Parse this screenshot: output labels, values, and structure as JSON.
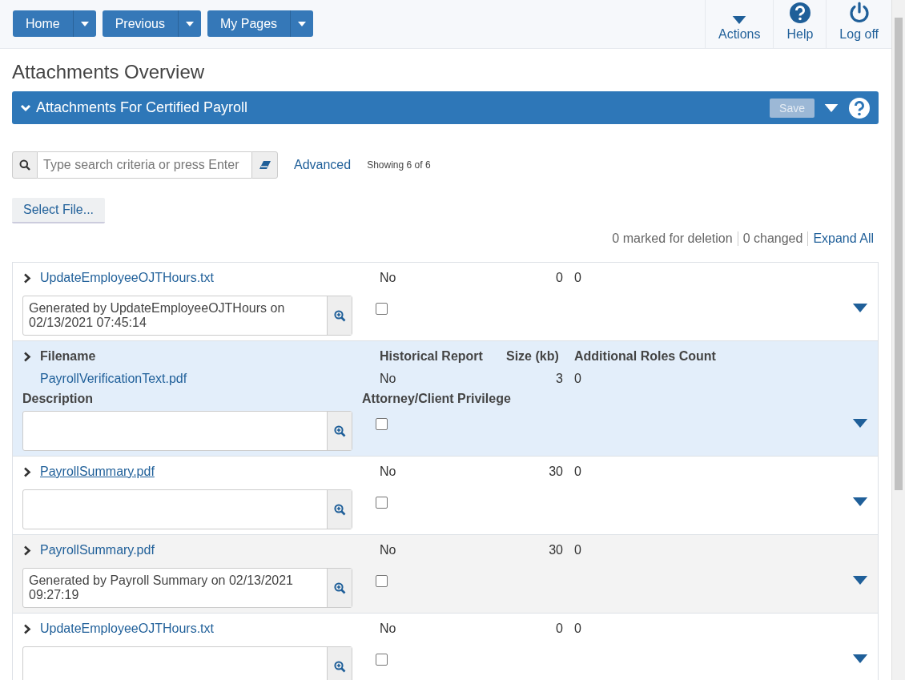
{
  "nav": {
    "buttons": [
      {
        "label": "Home"
      },
      {
        "label": "Previous"
      },
      {
        "label": "My Pages"
      }
    ],
    "actions": [
      {
        "kind": "caret",
        "label": "Actions"
      },
      {
        "kind": "help",
        "label": "Help"
      },
      {
        "kind": "power",
        "label": "Log off"
      }
    ]
  },
  "page_title": "Attachments Overview",
  "panel": {
    "title": "Attachments For Certified Payroll",
    "expanded": true,
    "save": {
      "label": "Save",
      "disabled": true
    }
  },
  "search": {
    "placeholder": "Type search criteria or press Enter"
  },
  "advanced": "Advanced",
  "showing": "Showing 6 of 6",
  "select_file": "Select File...",
  "summary": {
    "marked": "0 marked for deletion",
    "changed": "0 changed",
    "expand_all": "Expand All"
  },
  "rows": [
    {
      "filename": "UpdateEmployeeOJTHours.txt",
      "historical": "No",
      "size": "0",
      "roles": "0",
      "description": "Generated by UpdateEmployeeOJTHours on 02/13/2021 07:45:14",
      "privileged": false,
      "selected": false,
      "striped": false,
      "underlined": false
    },
    {
      "filename": "PayrollVerificationText.pdf",
      "historical": "No",
      "size": "3",
      "roles": "0",
      "privileged": false,
      "selected": true,
      "striped": false,
      "underlined": false,
      "headers": {
        "filename": "Filename",
        "historical": "Historical Report",
        "size": "Size (kb)",
        "roles": "Additional Roles Count",
        "description": "Description",
        "privilege": "Attorney/Client Privilege"
      }
    },
    {
      "filename": "PayrollSummary.pdf",
      "historical": "No",
      "size": "30",
      "roles": "0",
      "privileged": false,
      "selected": false,
      "striped": false,
      "underlined": true
    },
    {
      "filename": "PayrollSummary.pdf",
      "historical": "No",
      "size": "30",
      "roles": "0",
      "description": "Generated by Payroll Summary on 02/13/2021 09:27:19",
      "privileged": false,
      "selected": false,
      "striped": true,
      "underlined": false
    },
    {
      "filename": "UpdateEmployeeOJTHours.txt",
      "historical": "No",
      "size": "0",
      "roles": "0",
      "privileged": false,
      "selected": false,
      "striped": false,
      "underlined": false
    }
  ]
}
